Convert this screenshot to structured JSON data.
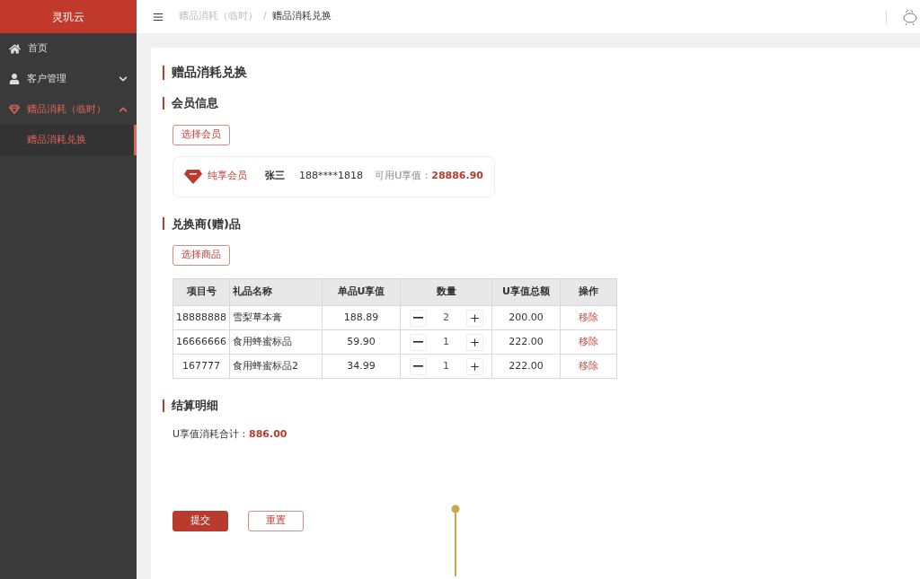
{
  "sidebar": {
    "logo": "灵玑云",
    "items": [
      {
        "label": "首页",
        "selected": false
      },
      {
        "label": "客户管理",
        "expanded": false,
        "selected": false
      },
      {
        "label": "赠品消耗（临时）",
        "expanded": true,
        "selected": true,
        "children": [
          {
            "label": "赠品消耗兑换",
            "selected": true
          }
        ]
      }
    ]
  },
  "breadcrumb": [
    "赠品消耗（临时）",
    "/",
    "赠品消耗兑换"
  ],
  "page_title": "赠品消耗兑换",
  "member_section": {
    "title": "会员信息",
    "button": "选择会员",
    "member": {
      "level": "纯享会员",
      "name": "张三",
      "phone": "188****1818",
      "balance_label": "可用U享值：",
      "balance": "28886.90"
    }
  },
  "goods_section": {
    "title": "兑换商(赠)品",
    "button": "选择商品",
    "table": {
      "columns": [
        "项目号",
        "礼品名称",
        "单品U享值",
        "数量",
        "U享值总额",
        "操作"
      ],
      "rows": [
        {
          "id": "18888888",
          "name": "雪梨草本膏",
          "price": "188.89",
          "qty": "2",
          "total": "200.00",
          "action": "移除"
        },
        {
          "id": "16666666",
          "name": "食用蜂蜜标品",
          "price": "59.90",
          "qty": "1",
          "total": "222.00",
          "action": "移除"
        },
        {
          "id": "167777",
          "name": "食用蜂蜜标品2",
          "price": "34.99",
          "qty": "1",
          "total": "222.00",
          "action": "移除"
        }
      ]
    }
  },
  "summary_section": {
    "title": "结算明细",
    "label": "U享值消耗合计：",
    "value": "886.00"
  },
  "buttons": [
    {
      "label": "提交",
      "kind": "primary"
    },
    {
      "label": "重置",
      "kind": "outline"
    }
  ]
}
